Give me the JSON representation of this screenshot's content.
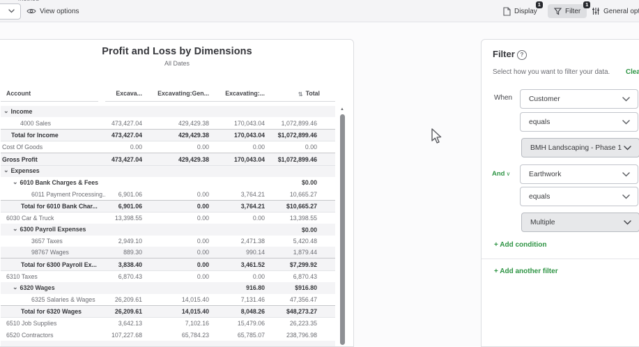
{
  "colors": {
    "page_bg": "#fbfbfc",
    "toolbar_bg": "#f4f4f6",
    "toolbar_border": "#e2e3e7",
    "border": "#dcdde1",
    "control_border": "#c1c4cb",
    "text": "#393a3d",
    "muted": "#6b6c72",
    "green": "#2e9444",
    "shaded": "#f4f4f6",
    "badge": "#26282d",
    "gray_fill": "#e7e8ea"
  },
  "toolbar": {
    "clipped_label": "method",
    "view_options": "View options",
    "display_label": "Display",
    "display_badge": "1",
    "filter_label": "Filter",
    "filter_badge": "1",
    "general_options_label": "General options"
  },
  "report": {
    "title": "Profit and Loss by Dimensions",
    "subtitle": "All Dates",
    "columns": [
      "Account",
      "Excava...",
      "Excavating:Gen...",
      "Excavating:...",
      "Total"
    ],
    "rows": [
      {
        "label": "Income",
        "values": [
          "",
          "",
          "",
          ""
        ],
        "indent": 4,
        "chevron": true,
        "w": "s",
        "shaded": true,
        "line": false
      },
      {
        "label": "4000 Sales",
        "values": [
          "473,427.04",
          "429,429.38",
          "170,043.04",
          "1,072,899.46"
        ],
        "indent": 28,
        "chevron": false,
        "w": "n",
        "shaded": false,
        "line": false
      },
      {
        "label": "Total for Income",
        "values": [
          "473,427.04",
          "429,429.38",
          "170,043.04",
          "$1,072,899.46"
        ],
        "indent": 15,
        "chevron": false,
        "w": "b",
        "shaded": true,
        "line": true
      },
      {
        "label": "Cost Of Goods",
        "values": [
          "0.00",
          "0.00",
          "0.00",
          "0.00"
        ],
        "indent": 2,
        "chevron": false,
        "w": "n",
        "shaded": false,
        "line": false
      },
      {
        "label": "Gross Profit",
        "values": [
          "473,427.04",
          "429,429.38",
          "170,043.04",
          "$1,072,899.46"
        ],
        "indent": 2,
        "chevron": false,
        "w": "b",
        "shaded": true,
        "line": true
      },
      {
        "label": "Expenses",
        "values": [
          "",
          "",
          "",
          ""
        ],
        "indent": 4,
        "chevron": true,
        "w": "s",
        "shaded": true,
        "line": false
      },
      {
        "label": "6010 Bank Charges & Fees",
        "values": [
          "",
          "",
          "",
          "$0.00"
        ],
        "indent": 17,
        "chevron": true,
        "w": "s",
        "shaded": false,
        "line": false
      },
      {
        "label": "6011 Payment Processing...",
        "values": [
          "6,901.06",
          "0.00",
          "3,764.21",
          "10,665.27"
        ],
        "indent": 44,
        "chevron": false,
        "w": "n",
        "shaded": false,
        "line": false
      },
      {
        "label": "Total for 6010 Bank Char...",
        "values": [
          "6,901.06",
          "0.00",
          "3,764.21",
          "$10,665.27"
        ],
        "indent": 29,
        "chevron": false,
        "w": "b",
        "shaded": true,
        "line": true
      },
      {
        "label": "6030 Car & Truck",
        "values": [
          "13,398.55",
          "0.00",
          "0.00",
          "13,398.55"
        ],
        "indent": 8,
        "chevron": false,
        "w": "n",
        "shaded": false,
        "line": false
      },
      {
        "label": "6300 Payroll Expenses",
        "values": [
          "",
          "",
          "",
          "$0.00"
        ],
        "indent": 17,
        "chevron": true,
        "w": "s",
        "shaded": true,
        "line": false
      },
      {
        "label": "3657 Taxes",
        "values": [
          "2,949.10",
          "0.00",
          "2,471.38",
          "5,420.48"
        ],
        "indent": 44,
        "chevron": false,
        "w": "n",
        "shaded": false,
        "line": false
      },
      {
        "label": "98767 Wages",
        "values": [
          "889.30",
          "0.00",
          "990.14",
          "1,879.44"
        ],
        "indent": 44,
        "chevron": false,
        "w": "n",
        "shaded": true,
        "line": false
      },
      {
        "label": "Total for 6300 Payroll Ex...",
        "values": [
          "3,838.40",
          "0.00",
          "3,461.52",
          "$7,299.92"
        ],
        "indent": 29,
        "chevron": false,
        "w": "b",
        "shaded": true,
        "line": true
      },
      {
        "label": "6310 Taxes",
        "values": [
          "6,870.43",
          "0.00",
          "0.00",
          "6,870.43"
        ],
        "indent": 8,
        "chevron": false,
        "w": "n",
        "shaded": false,
        "line": false
      },
      {
        "label": "6320 Wages",
        "values": [
          "",
          "",
          "916.80",
          "$916.80"
        ],
        "indent": 17,
        "chevron": true,
        "w": "s",
        "shaded": true,
        "line": false
      },
      {
        "label": "6325 Salaries & Wages",
        "values": [
          "26,209.61",
          "14,015.40",
          "7,131.46",
          "47,356.47"
        ],
        "indent": 44,
        "chevron": false,
        "w": "n",
        "shaded": false,
        "line": false
      },
      {
        "label": "Total for 6320 Wages",
        "values": [
          "26,209.61",
          "14,015.40",
          "8,048.26",
          "$48,273.27"
        ],
        "indent": 29,
        "chevron": false,
        "w": "b",
        "shaded": true,
        "line": true
      },
      {
        "label": "6510 Job Supplies",
        "values": [
          "3,642.13",
          "7,102.16",
          "15,479.06",
          "26,223.35"
        ],
        "indent": 8,
        "chevron": false,
        "w": "n",
        "shaded": false,
        "line": false
      },
      {
        "label": "6520 Contractors",
        "values": [
          "107,227.68",
          "65,784.23",
          "65,785.07",
          "238,796.98"
        ],
        "indent": 8,
        "chevron": false,
        "w": "n",
        "shaded": false,
        "line": false
      },
      {
        "label": "",
        "values": [
          "",
          "",
          "",
          ""
        ],
        "indent": 8,
        "chevron": false,
        "w": "n",
        "shaded": true,
        "line": false
      }
    ]
  },
  "filter_panel": {
    "title": "Filter",
    "subtitle": "Select how you want to filter your data.",
    "clear_all": "Clear all",
    "when_label": "When",
    "and_label": "And",
    "filters": [
      {
        "field": "Customer",
        "operator": "equals",
        "value": "BMH Landscaping - Phase 1"
      },
      {
        "field": "Earthwork",
        "operator": "equals",
        "value": "Multiple"
      }
    ],
    "add_condition": "+ Add condition",
    "add_another_filter": "+ Add another filter"
  }
}
